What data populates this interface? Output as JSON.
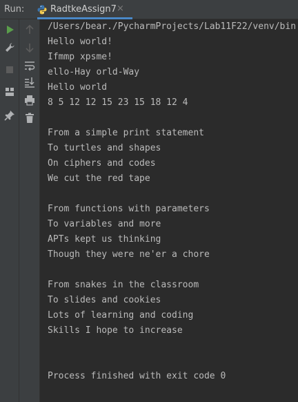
{
  "run_label": "Run:",
  "tab": {
    "label": "RadtkeAssign7",
    "close": "×",
    "icon": "python-icon"
  },
  "left_toolbar": [
    {
      "name": "rerun-icon",
      "color": "#5a9e4b"
    },
    {
      "name": "wrench-icon",
      "color": "#afb1b3"
    },
    {
      "name": "stop-icon",
      "color": "#5c5c5c"
    },
    {
      "name": "layout-icon",
      "color": "#afb1b3"
    },
    {
      "name": "pin-icon",
      "color": "#afb1b3"
    }
  ],
  "right_toolbar": [
    {
      "name": "up-arrow-icon"
    },
    {
      "name": "down-arrow-icon"
    },
    {
      "name": "soft-wrap-icon"
    },
    {
      "name": "scroll-to-end-icon"
    },
    {
      "name": "print-icon"
    },
    {
      "name": "trash-icon"
    }
  ],
  "console": {
    "lines": [
      "/Users/bear./PycharmProjects/Lab11F22/venv/bin",
      "Hello world!",
      "Ifmmp xpsme!",
      "ello-Hay orld-Way",
      "Hello world",
      "8 5 12 12 15 23 15 18 12 4",
      "",
      "From a simple print statement",
      "To turtles and shapes",
      "On ciphers and codes",
      "We cut the red tape",
      "",
      "From functions with parameters",
      "To variables and more",
      "APTs kept us thinking",
      "Though they were ne'er a chore",
      "",
      "From snakes in the classroom",
      "To slides and cookies",
      "Lots of learning and coding",
      "Skills I hope to increase",
      "",
      "",
      "Process finished with exit code 0"
    ]
  }
}
